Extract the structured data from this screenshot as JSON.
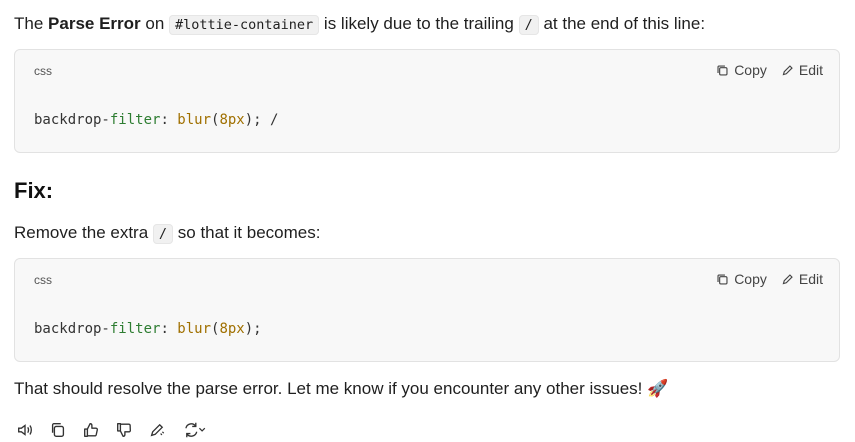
{
  "intro": {
    "pre": "The ",
    "bold": "Parse Error",
    "mid": " on ",
    "code": "#lottie-container",
    "post": " is likely due to the trailing ",
    "code2": "/",
    "end": " at the end of this line:"
  },
  "block1": {
    "lang": "css",
    "copy": "Copy",
    "edit": "Edit",
    "tokens": {
      "p1": "backdrop-",
      "p2": "filter",
      "p3": ": ",
      "fn": "blur",
      "o": "(",
      "num": "8px",
      "c": "); /"
    }
  },
  "fix_heading": "Fix:",
  "fix_para": {
    "pre": "Remove the extra ",
    "code": "/",
    "post": " so that it becomes:"
  },
  "block2": {
    "lang": "css",
    "copy": "Copy",
    "edit": "Edit",
    "tokens": {
      "p1": "backdrop-",
      "p2": "filter",
      "p3": ": ",
      "fn": "blur",
      "o": "(",
      "num": "8px",
      "c": ");"
    }
  },
  "closing": "That should resolve the parse error. Let me know if you encounter any other issues! 🚀",
  "toolbar": [
    "speaker-icon",
    "copy-icon",
    "thumbs-up-icon",
    "thumbs-down-icon",
    "edit-icon",
    "regenerate-icon"
  ]
}
